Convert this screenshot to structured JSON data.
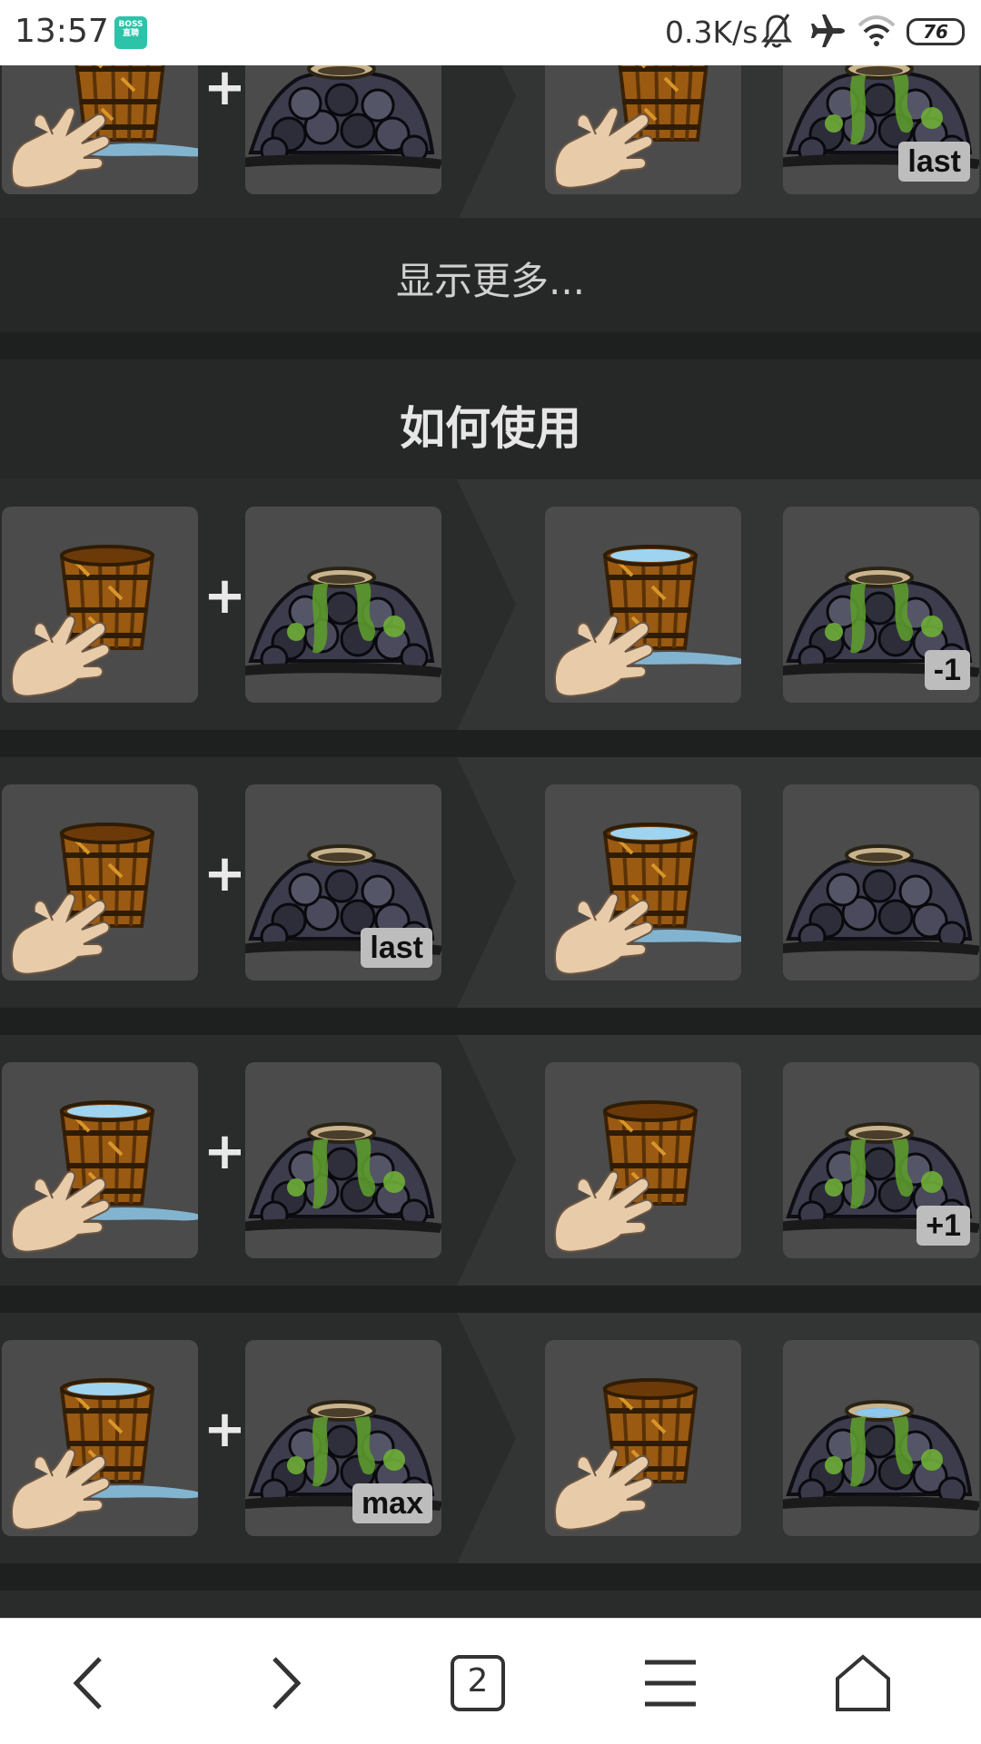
{
  "status_bar": {
    "time": "13:57",
    "app_badge": "BOSS直聘",
    "network_speed": "0.3K/s",
    "icons": [
      "mute-bell-icon",
      "airplane-icon",
      "wifi-icon"
    ],
    "battery": "76"
  },
  "top_recipe": {
    "result_badge": "last"
  },
  "show_more": "显示更多...",
  "section": {
    "title": "如何使用"
  },
  "recipes": [
    {
      "left_badge": "",
      "result_badge": "-1"
    },
    {
      "left_badge": "last",
      "result_badge": ""
    },
    {
      "left_badge": "",
      "result_badge": "+1"
    },
    {
      "left_badge": "max",
      "result_badge": ""
    }
  ],
  "nav": {
    "tabs_count": "2",
    "icons": [
      "back-icon",
      "forward-icon",
      "tabs-icon",
      "menu-icon",
      "home-icon"
    ]
  },
  "colors": {
    "background": "#1e1f1f",
    "tile": "#4b4b4b",
    "badge": "#bdbdbd"
  }
}
